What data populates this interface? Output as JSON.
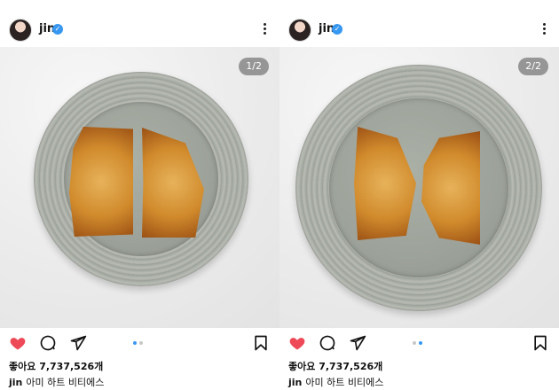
{
  "colors": {
    "heart": "#ed4956",
    "verified": "#3897f0",
    "dot_active": "#3897f0",
    "dot_inactive": "#c7c7c7"
  },
  "posts": [
    {
      "username": "jin",
      "pager": "1/2",
      "active_slide": 1,
      "likes": "좋아요 7,737,526개",
      "caption_user": "jin",
      "caption_text": "아미 하트 비티에스"
    },
    {
      "username": "jin",
      "pager": "2/2",
      "active_slide": 2,
      "likes": "좋아요 7,737,526개",
      "caption_user": "jin",
      "caption_text": "아미 하트 비티에스"
    }
  ],
  "icons": {
    "like": "heart-icon",
    "comment": "comment-icon",
    "share": "share-icon",
    "save": "bookmark-icon",
    "more": "more-icon",
    "verified": "verified-badge-icon"
  }
}
